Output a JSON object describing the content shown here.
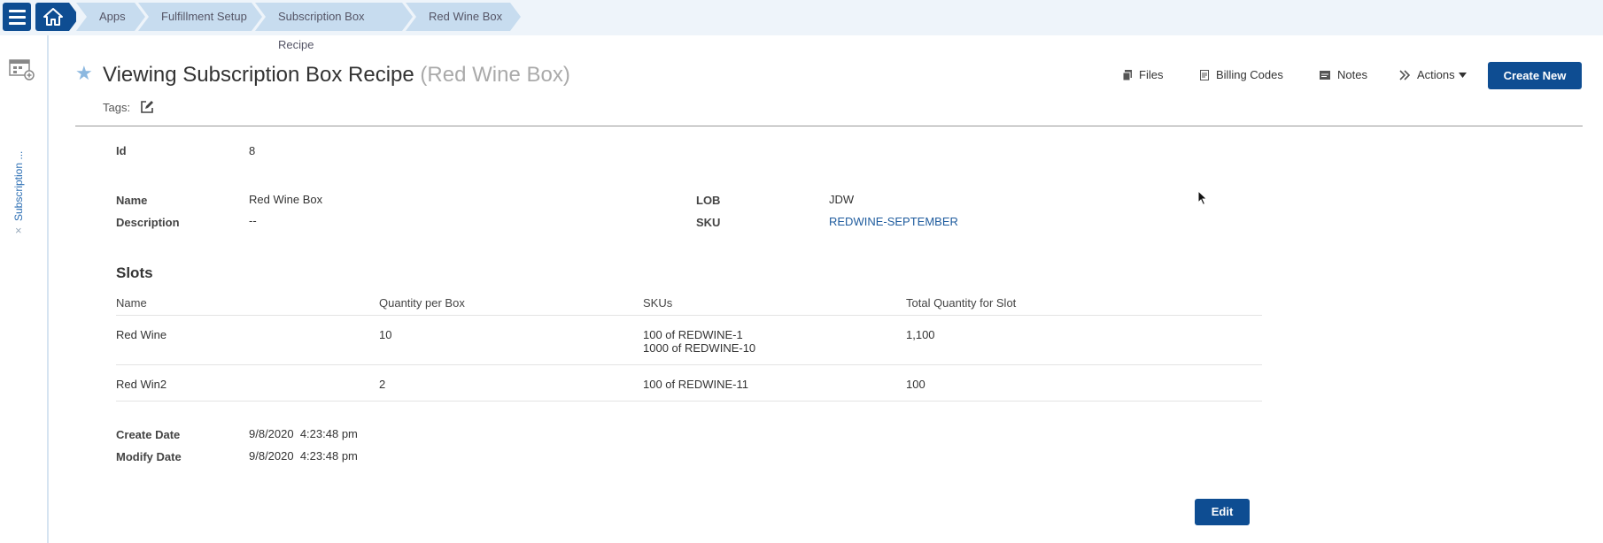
{
  "breadcrumb": {
    "items": [
      "Apps",
      "Fulfillment Setup",
      "Subscription Box Recipe",
      "Red Wine Box"
    ]
  },
  "rail": {
    "label": "Subscription ...",
    "close": "×"
  },
  "header": {
    "title": "Viewing Subscription Box Recipe",
    "subtitle": "(Red Wine Box)",
    "tags_label": "Tags:"
  },
  "actions": {
    "files": "Files",
    "billing_codes": "Billing Codes",
    "notes": "Notes",
    "actions": "Actions",
    "create_new": "Create New"
  },
  "fields": {
    "id_label": "Id",
    "id_value": "8",
    "name_label": "Name",
    "name_value": "Red Wine Box",
    "description_label": "Description",
    "description_value": "--",
    "lob_label": "LOB",
    "lob_value": "JDW",
    "sku_label": "SKU",
    "sku_value": "REDWINE-SEPTEMBER"
  },
  "slots": {
    "title": "Slots",
    "columns": [
      "Name",
      "Quantity per Box",
      "SKUs",
      "Total Quantity for Slot"
    ],
    "rows": [
      {
        "name": "Red Wine",
        "quantity": "10",
        "skus": [
          "100 of REDWINE-1",
          "1000 of REDWINE-10"
        ],
        "total": "1,100"
      },
      {
        "name": "Red Win2",
        "quantity": "2",
        "skus": [
          "100 of REDWINE-11"
        ],
        "total": "100"
      }
    ]
  },
  "dates": {
    "create_label": "Create Date",
    "create_value": "9/8/2020  4:23:48 pm",
    "modify_label": "Modify Date",
    "modify_value": "9/8/2020  4:23:48 pm"
  },
  "edit_button": "Edit",
  "colors": {
    "primary": "#0e4d92",
    "breadcrumb_bg": "#c7dcef",
    "topbar_bg": "#eef4fa",
    "link": "#1f5c9e"
  }
}
